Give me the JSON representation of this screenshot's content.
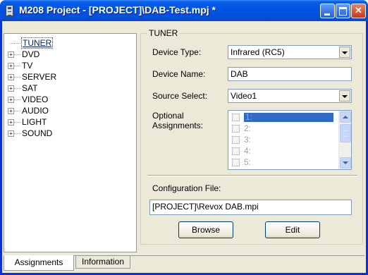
{
  "window": {
    "title": "M208 Project - [PROJECT]\\DAB-Test.mpj *"
  },
  "tree": {
    "items": [
      {
        "label": "TUNER",
        "expandable": false,
        "selected": true
      },
      {
        "label": "DVD",
        "expandable": true
      },
      {
        "label": "TV",
        "expandable": true
      },
      {
        "label": "SERVER",
        "expandable": true
      },
      {
        "label": "SAT",
        "expandable": true
      },
      {
        "label": "VIDEO",
        "expandable": true
      },
      {
        "label": "AUDIO",
        "expandable": true
      },
      {
        "label": "LIGHT",
        "expandable": true
      },
      {
        "label": "SOUND",
        "expandable": true
      }
    ],
    "expand_glyph": "+"
  },
  "tabs": {
    "assignments": "Assignments",
    "information": "Information"
  },
  "panel": {
    "group_title": "TUNER",
    "device_type_label": "Device Type:",
    "device_type_value": "Infrared (RC5)",
    "device_name_label": "Device Name:",
    "device_name_value": "DAB",
    "source_select_label": "Source Select:",
    "source_select_value": "Video1",
    "optional_label_line1": "Optional",
    "optional_label_line2": "Assignments:",
    "optional_items": [
      "1:",
      "2:",
      "3:",
      "4:",
      "5:"
    ],
    "config_label": "Configuration File:",
    "config_value": "[PROJECT]\\Revox DAB.mpi",
    "browse_label": "Browse",
    "edit_label": "Edit"
  },
  "colors": {
    "titlebar": "#0054e3",
    "selection": "#316ac5",
    "window_bg": "#ece9d8"
  }
}
